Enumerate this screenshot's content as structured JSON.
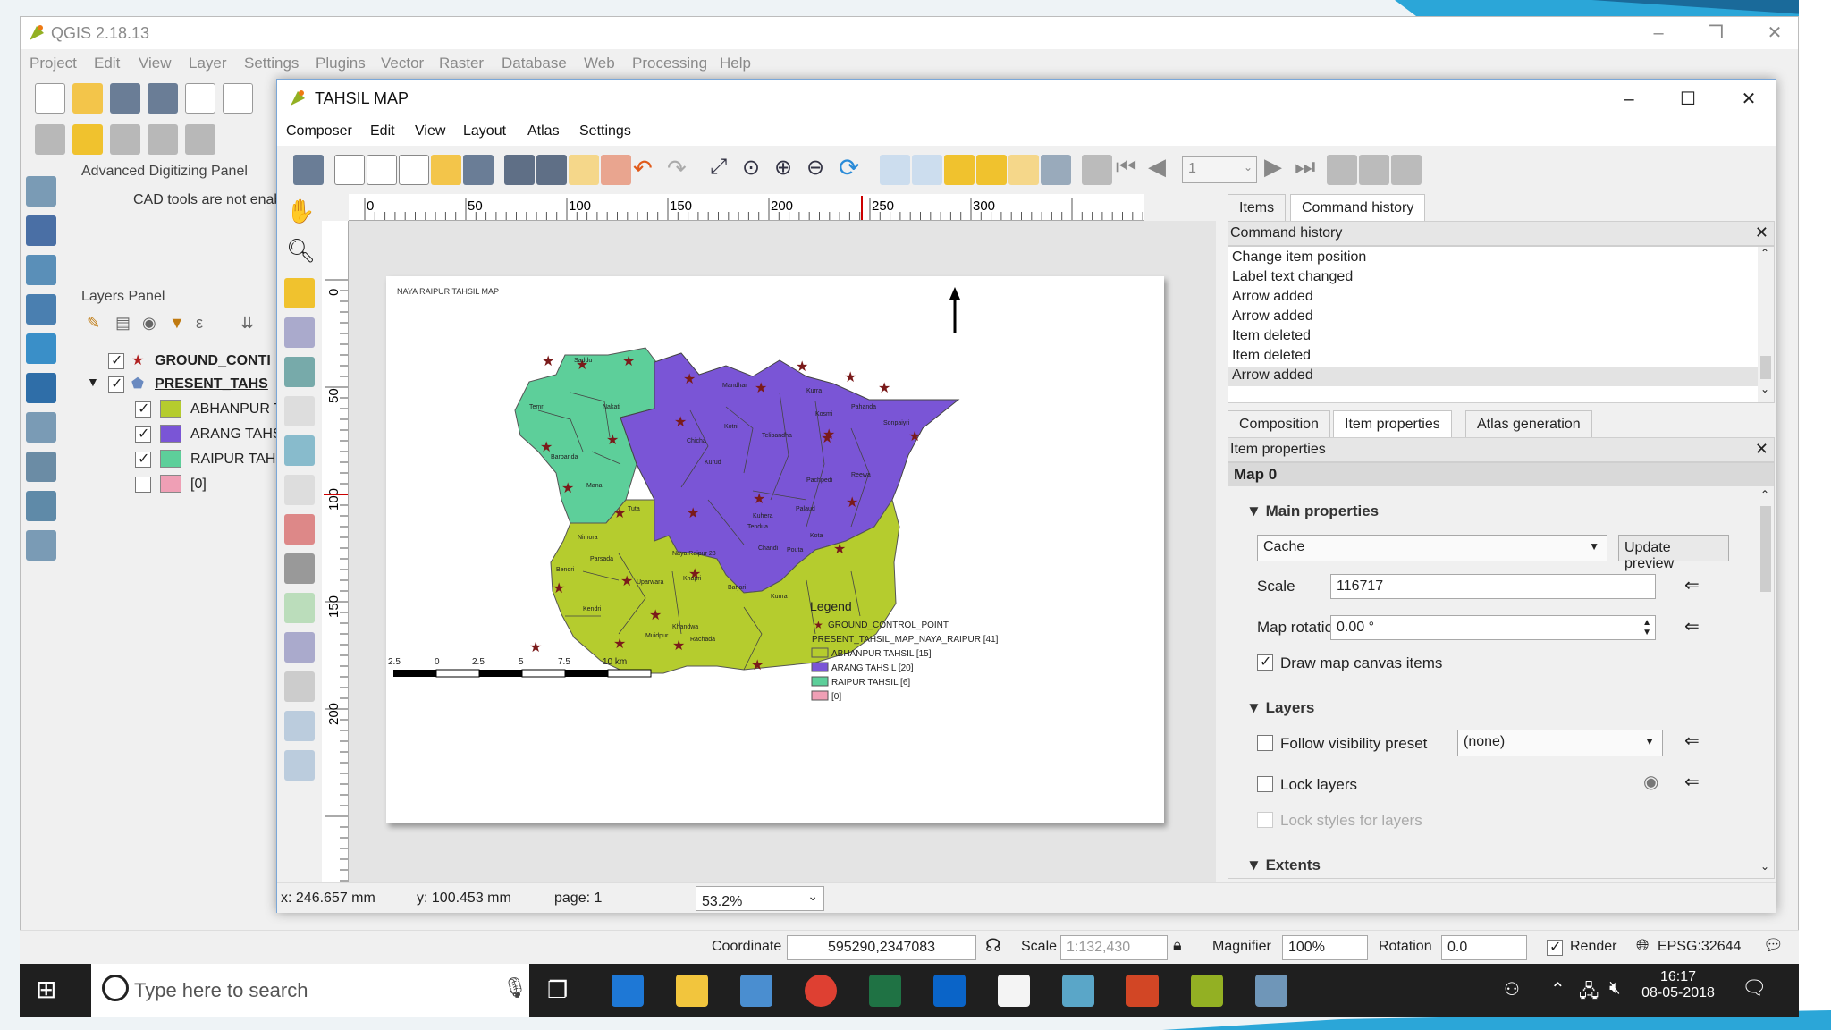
{
  "qgis": {
    "title": "QGIS 2.18.13",
    "menu": [
      "Project",
      "Edit",
      "View",
      "Layer",
      "Settings",
      "Plugins",
      "Vector",
      "Raster",
      "Database",
      "Web",
      "Processing",
      "Help"
    ]
  },
  "digitizing": {
    "title": "Advanced Digitizing Panel",
    "message": "CAD tools are not enab"
  },
  "layers_panel": {
    "title": "Layers Panel",
    "layers": [
      {
        "name": "GROUND_CONTI",
        "checked": true,
        "bold": true,
        "icon": "star-icon"
      },
      {
        "name": "PRESENT_TAHS",
        "checked": true,
        "bold": true,
        "underline": true,
        "icon": "polygon-layer-icon"
      },
      {
        "name": "ABHANPUR T.",
        "checked": true,
        "color": "#b5cc2e"
      },
      {
        "name": "ARANG TAHS",
        "checked": true,
        "color": "#7a55d6"
      },
      {
        "name": "RAIPUR TAHS",
        "checked": true,
        "color": "#5dcf9a"
      },
      {
        "name": "[0]",
        "checked": false,
        "color": "#ef7f9c"
      }
    ]
  },
  "composer": {
    "title": "TAHSIL MAP",
    "menu": [
      "Composer",
      "Edit",
      "View",
      "Layout",
      "Atlas",
      "Settings"
    ],
    "atlas_page": "1",
    "ruler_h": [
      "0",
      "50",
      "100",
      "150",
      "200",
      "250",
      "300"
    ],
    "ruler_v": [
      "0",
      "50",
      "100",
      "150",
      "200"
    ],
    "status": {
      "x": "x: 246.657 mm",
      "y": "y: 100.453 mm",
      "page": "page: 1",
      "zoom": "53.2%"
    }
  },
  "map": {
    "page_title": "NAYA RAIPUR TAHSIL MAP",
    "regions": {
      "abhanpur": "#b5cc2e",
      "arang": "#7a55d6",
      "raipur": "#5dcf9a"
    },
    "labels": [
      "Saddu",
      "Nakati",
      "Temri",
      "Barbanda",
      "Mana",
      "Tuta",
      "Nimora",
      "Parsada",
      "Bendri",
      "Kendri",
      "Uparwara",
      "Khandwa",
      "Muidpur",
      "Rachada",
      "Barjari",
      "Kunra",
      "Chandi",
      "Pouta",
      "Tendua",
      "Kota",
      "Naya Raipur 28",
      "Khapri",
      "Chicha",
      "Kurud",
      "Kotni",
      "Telibandha",
      "Kuhera",
      "Palaud",
      "Pachpedi",
      "Reewa",
      "Kosmi",
      "Kurra",
      "Pahanda",
      "Sonpaiyri",
      "Mandhar"
    ],
    "scalebar": [
      "2.5",
      "0",
      "2.5",
      "5",
      "7.5",
      "10 km"
    ],
    "legend": {
      "title": "Legend",
      "items": [
        {
          "label": "GROUND_CONTROL_POINT",
          "type": "star"
        },
        {
          "label": "PRESENT_TAHSIL_MAP_NAYA_RAIPUR [41]",
          "type": "none"
        },
        {
          "label": "ABHANPUR TAHSIL [15]",
          "color": "#b5cc2e"
        },
        {
          "label": "ARANG TAHSIL [20]",
          "color": "#7a55d6"
        },
        {
          "label": "RAIPUR TAHSIL [6]",
          "color": "#5dcf9a"
        },
        {
          "label": "[0]",
          "color": "#ef7f9c"
        }
      ]
    }
  },
  "right_panel": {
    "top_tabs": [
      "Items",
      "Command history"
    ],
    "history_title": "Command history",
    "history": [
      "Change item position",
      "Label text changed",
      "Arrow added",
      "Arrow added",
      "Item deleted",
      "Item deleted",
      "Arrow added"
    ],
    "mid_tabs": [
      "Composition",
      "Item properties",
      "Atlas generation"
    ],
    "props_title": "Item properties",
    "item_name": "Map 0",
    "main_props": "Main properties",
    "cache": "Cache",
    "update_preview": "Update preview",
    "scale_label": "Scale",
    "scale_value": "116717",
    "rotation_label": "Map rotation",
    "rotation_value": "0.00 °",
    "draw_canvas": "Draw map canvas items",
    "layers_section": "Layers",
    "follow_preset": "Follow visibility preset",
    "preset_value": "(none)",
    "lock_layers": "Lock layers",
    "lock_styles": "Lock styles for layers",
    "extents": "Extents"
  },
  "qgis_status": {
    "coord_label": "Coordinate",
    "coord": "595290,2347083",
    "scale_label": "Scale",
    "scale": "1:132,430",
    "mag_label": "Magnifier",
    "mag": "100%",
    "rot_label": "Rotation",
    "rot": "0.0",
    "render": "Render",
    "epsg": "EPSG:32644"
  },
  "taskbar": {
    "search": "Type here to search",
    "time": "16:17",
    "date": "08-05-2018"
  }
}
